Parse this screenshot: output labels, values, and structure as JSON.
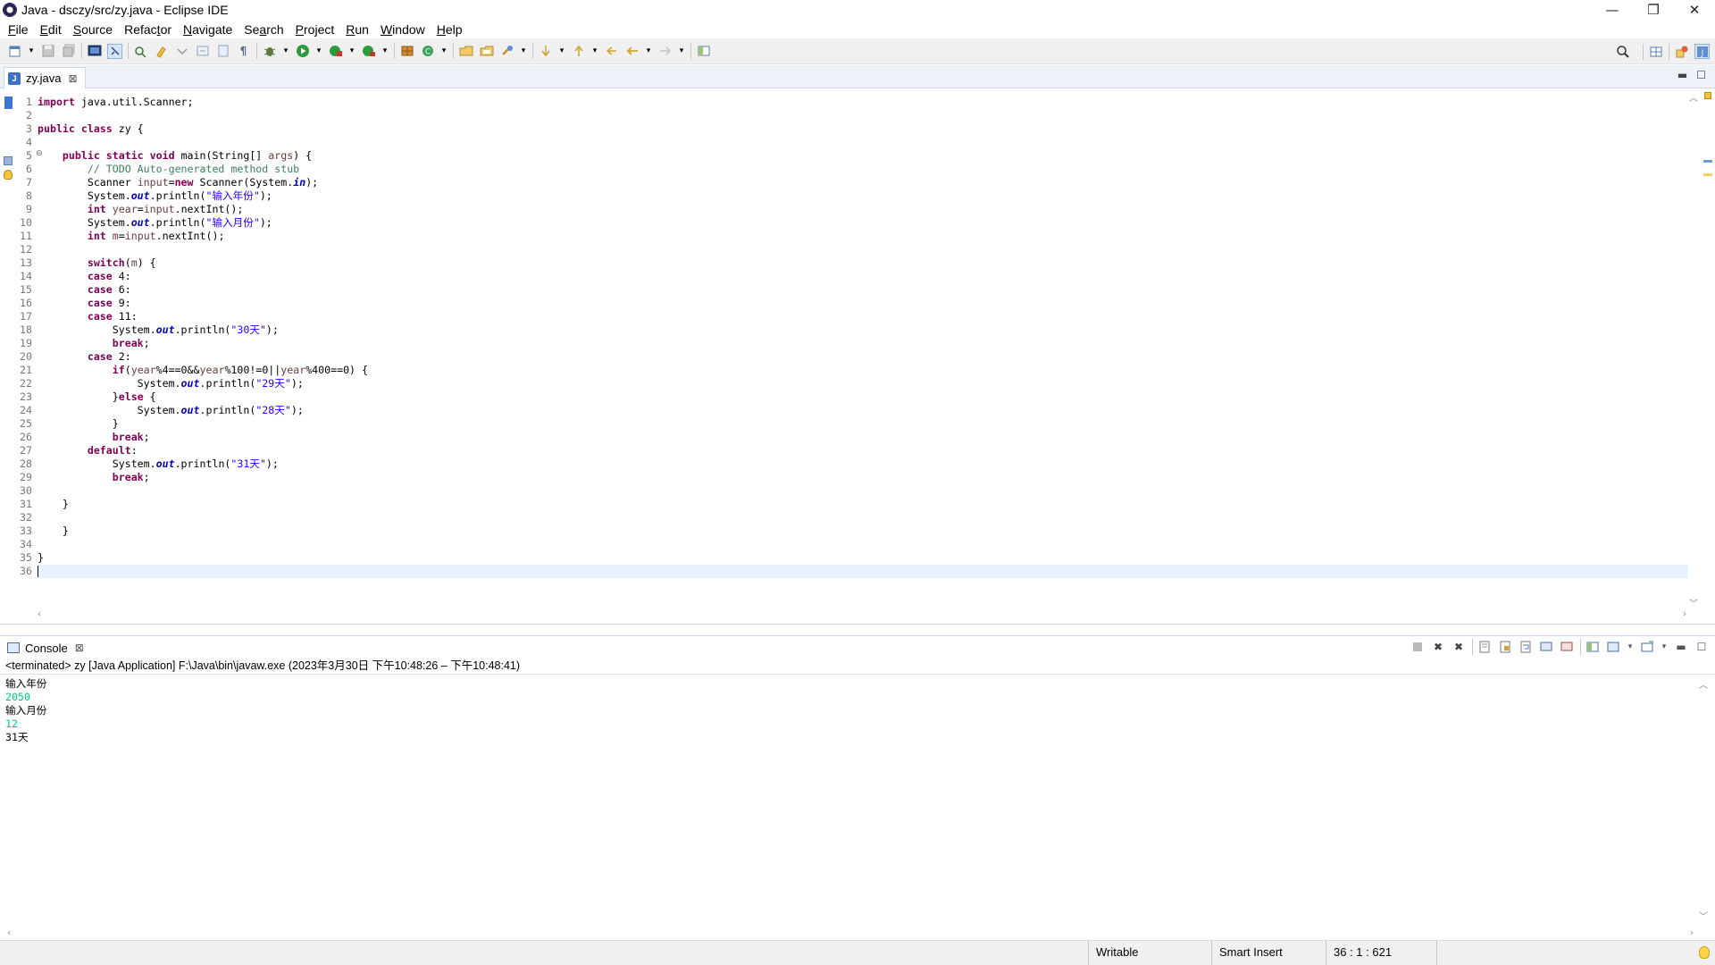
{
  "window": {
    "title": "Java - dsczy/src/zy.java - Eclipse IDE",
    "controls": {
      "minimize": "—",
      "restore": "❐",
      "close": "✕"
    }
  },
  "menu": [
    {
      "label": "File",
      "mnemonic": "F"
    },
    {
      "label": "Edit",
      "mnemonic": "E"
    },
    {
      "label": "Source",
      "mnemonic": "S"
    },
    {
      "label": "Refactor",
      "mnemonic": "t"
    },
    {
      "label": "Navigate",
      "mnemonic": "N"
    },
    {
      "label": "Search",
      "mnemonic": "a"
    },
    {
      "label": "Project",
      "mnemonic": "P"
    },
    {
      "label": "Run",
      "mnemonic": "R"
    },
    {
      "label": "Window",
      "mnemonic": "W"
    },
    {
      "label": "Help",
      "mnemonic": "H"
    }
  ],
  "toolbar_icons": [
    "new-icon",
    "save-icon",
    "save-all-icon",
    "terminal-icon",
    "toggle-mark-icon",
    "open-type-icon",
    "highlight-icon",
    "next-annotation-icon",
    "prev-annotation-icon",
    "word-wrap-icon",
    "show-whitespace-icon",
    "debug-icon",
    "run-icon",
    "coverage-icon",
    "external-tools-icon",
    "new-java-package-icon",
    "new-java-class-icon",
    "open-type-dialog-icon",
    "open-task-icon",
    "search-icon",
    "next-edit-icon",
    "prev-edit-icon",
    "back-icon",
    "forward-icon",
    "pin-editor-icon"
  ],
  "editor": {
    "tab": {
      "label": "zy.java",
      "close": "⊠"
    },
    "cursor_line": 36,
    "lines": [
      {
        "n": "1",
        "html": "<span class=\"kw\">import</span> java.util.Scanner;"
      },
      {
        "n": "2",
        "html": ""
      },
      {
        "n": "3",
        "html": "<span class=\"kw\">public class</span> zy {"
      },
      {
        "n": "4",
        "html": ""
      },
      {
        "n": "5",
        "html": "    <span class=\"kw\">public static void</span> main(String[] <span class=\"var\">args</span>) {"
      },
      {
        "n": "6",
        "html": "        <span class=\"cm\">// TODO Auto-generated method stub</span>"
      },
      {
        "n": "7",
        "html": "        Scanner <span class=\"var\">input</span>=<span class=\"kw\">new</span> Scanner(System.<span class=\"fld\">in</span>);"
      },
      {
        "n": "8",
        "html": "        System.<span class=\"fld\">out</span>.println(<span class=\"str\">\"输入年份\"</span>);"
      },
      {
        "n": "9",
        "html": "        <span class=\"kw\">int</span> <span class=\"var\">year</span>=<span class=\"var\">input</span>.nextInt();"
      },
      {
        "n": "10",
        "html": "        System.<span class=\"fld\">out</span>.println(<span class=\"str\">\"输入月份\"</span>);"
      },
      {
        "n": "11",
        "html": "        <span class=\"kw\">int</span> <span class=\"var\">m</span>=<span class=\"var\">input</span>.nextInt();"
      },
      {
        "n": "12",
        "html": ""
      },
      {
        "n": "13",
        "html": "        <span class=\"kw\">switch</span>(<span class=\"var\">m</span>) {"
      },
      {
        "n": "14",
        "html": "        <span class=\"kw\">case</span> 4:"
      },
      {
        "n": "15",
        "html": "        <span class=\"kw\">case</span> 6:"
      },
      {
        "n": "16",
        "html": "        <span class=\"kw\">case</span> 9:"
      },
      {
        "n": "17",
        "html": "        <span class=\"kw\">case</span> 11:"
      },
      {
        "n": "18",
        "html": "            System.<span class=\"fld\">out</span>.println(<span class=\"str\">\"30天\"</span>);"
      },
      {
        "n": "19",
        "html": "            <span class=\"kw\">break</span>;"
      },
      {
        "n": "20",
        "html": "        <span class=\"kw\">case</span> 2:"
      },
      {
        "n": "21",
        "html": "            <span class=\"kw\">if</span>(<span class=\"var\">year</span>%4==0&amp;&amp;<span class=\"var\">year</span>%100!=0||<span class=\"var\">year</span>%400==0) {"
      },
      {
        "n": "22",
        "html": "                System.<span class=\"fld\">out</span>.println(<span class=\"str\">\"29天\"</span>);"
      },
      {
        "n": "23",
        "html": "            }<span class=\"kw\">else</span> {"
      },
      {
        "n": "24",
        "html": "                System.<span class=\"fld\">out</span>.println(<span class=\"str\">\"28天\"</span>);"
      },
      {
        "n": "25",
        "html": "            }"
      },
      {
        "n": "26",
        "html": "            <span class=\"kw\">break</span>;"
      },
      {
        "n": "27",
        "html": "        <span class=\"kw\">default</span>:"
      },
      {
        "n": "28",
        "html": "            System.<span class=\"fld\">out</span>.println(<span class=\"str\">\"31天\"</span>);"
      },
      {
        "n": "29",
        "html": "            <span class=\"kw\">break</span>;"
      },
      {
        "n": "30",
        "html": ""
      },
      {
        "n": "31",
        "html": "    }"
      },
      {
        "n": "32",
        "html": ""
      },
      {
        "n": "33",
        "html": "    }"
      },
      {
        "n": "34",
        "html": ""
      },
      {
        "n": "35",
        "html": "}"
      },
      {
        "n": "36",
        "html": ""
      }
    ]
  },
  "console": {
    "tab": {
      "label": "Console",
      "close": "⊠"
    },
    "status": "<terminated> zy [Java Application] F:\\Java\\bin\\javaw.exe  (2023年3月30日 下午10:48:26 – 下午10:48:41)",
    "lines": [
      {
        "text": "输入年份",
        "type": "output"
      },
      {
        "text": "2050",
        "type": "input"
      },
      {
        "text": "输入月份",
        "type": "output"
      },
      {
        "text": "12",
        "type": "input"
      },
      {
        "text": "31天",
        "type": "output"
      }
    ]
  },
  "statusbar": {
    "writable": "Writable",
    "insert_mode": "Smart Insert",
    "position": "36 : 1 : 621"
  },
  "colors": {
    "keyword": "#7f0055",
    "string": "#2a00ff",
    "comment": "#3f7f5f",
    "field": "#0000c0",
    "console_input": "#00c87d",
    "current_line": "#e8f2fe"
  }
}
